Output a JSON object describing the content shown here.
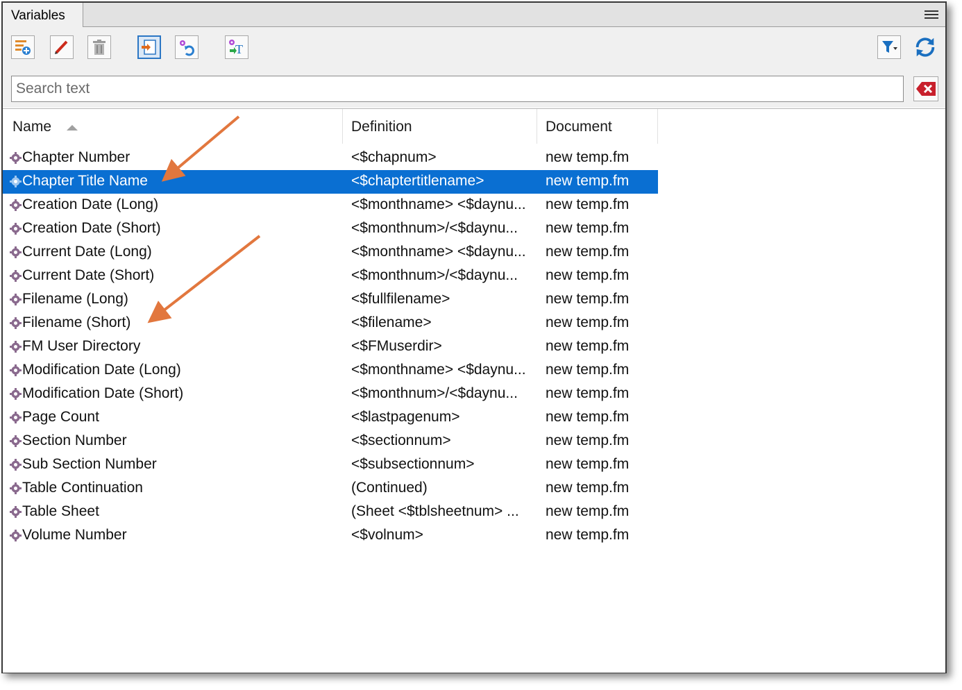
{
  "panel": {
    "tab_title": "Variables"
  },
  "toolbar": {
    "buttons": [
      {
        "name": "new-variable-icon"
      },
      {
        "name": "edit-pencil-icon"
      },
      {
        "name": "delete-trash-icon"
      },
      {
        "name": "insert-variable-icon"
      },
      {
        "name": "update-variables-icon"
      },
      {
        "name": "convert-to-text-icon"
      },
      {
        "name": "filter-icon"
      },
      {
        "name": "refresh-icon"
      }
    ]
  },
  "search": {
    "placeholder": "Search text",
    "value": ""
  },
  "columns": {
    "name": "Name",
    "definition": "Definition",
    "document": "Document"
  },
  "rows": [
    {
      "name": "Chapter Number",
      "definition": "<$chapnum>",
      "document": "new temp.fm"
    },
    {
      "name": "Chapter Title Name",
      "definition": "<$chaptertitlename>",
      "document": "new temp.fm",
      "selected": true
    },
    {
      "name": "Creation Date (Long)",
      "definition": "<$monthname> <$daynu...",
      "document": "new temp.fm"
    },
    {
      "name": "Creation Date (Short)",
      "definition": "<$monthnum>/<$daynu...",
      "document": "new temp.fm"
    },
    {
      "name": "Current Date (Long)",
      "definition": "<$monthname> <$daynu...",
      "document": "new temp.fm"
    },
    {
      "name": "Current Date (Short)",
      "definition": "<$monthnum>/<$daynu...",
      "document": "new temp.fm"
    },
    {
      "name": "Filename (Long)",
      "definition": "<$fullfilename>",
      "document": "new temp.fm"
    },
    {
      "name": "Filename (Short)",
      "definition": "<$filename>",
      "document": "new temp.fm"
    },
    {
      "name": "FM User Directory",
      "definition": "<$FMuserdir>",
      "document": "new temp.fm"
    },
    {
      "name": "Modification Date (Long)",
      "definition": "<$monthname> <$daynu...",
      "document": "new temp.fm"
    },
    {
      "name": "Modification Date (Short)",
      "definition": "<$monthnum>/<$daynu...",
      "document": "new temp.fm"
    },
    {
      "name": "Page Count",
      "definition": "<$lastpagenum>",
      "document": "new temp.fm"
    },
    {
      "name": "Section Number",
      "definition": "<$sectionnum>",
      "document": "new temp.fm"
    },
    {
      "name": "Sub Section Number",
      "definition": "<$subsectionnum>",
      "document": "new temp.fm"
    },
    {
      "name": "Table Continuation",
      "definition": " (Continued)",
      "document": "new temp.fm"
    },
    {
      "name": "Table Sheet",
      "definition": " (Sheet <$tblsheetnum> ...",
      "document": "new temp.fm"
    },
    {
      "name": "Volume Number",
      "definition": "<$volnum>",
      "document": "new temp.fm"
    }
  ],
  "colors": {
    "selection": "#0a6fd2",
    "annotation_arrow": "#e2773e",
    "gear": "#8a6a8e"
  }
}
